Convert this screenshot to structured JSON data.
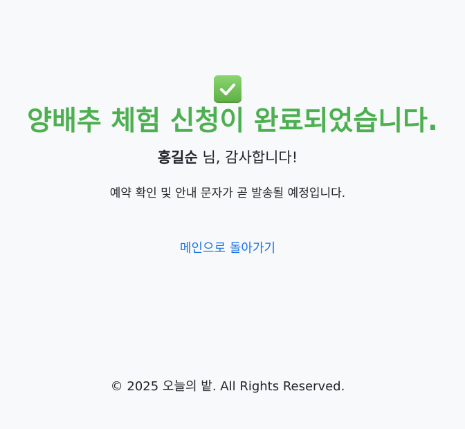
{
  "confirmation": {
    "icon": "check-mark-icon",
    "icon_color": "#6cc24a",
    "title": "양배추 체험 신청이 완료되었습니다.",
    "title_color": "#4caf50",
    "user_name": "홍길순",
    "thanks_suffix": " 님, 감사합니다!",
    "notice": "예약 확인 및 안내 문자가 곧 발송될 예정입니다.",
    "home_link_label": "메인으로 돌아가기",
    "link_color": "#1a73e8"
  },
  "footer": {
    "copyright": "© 2025 오늘의 밭. All Rights Reserved."
  }
}
